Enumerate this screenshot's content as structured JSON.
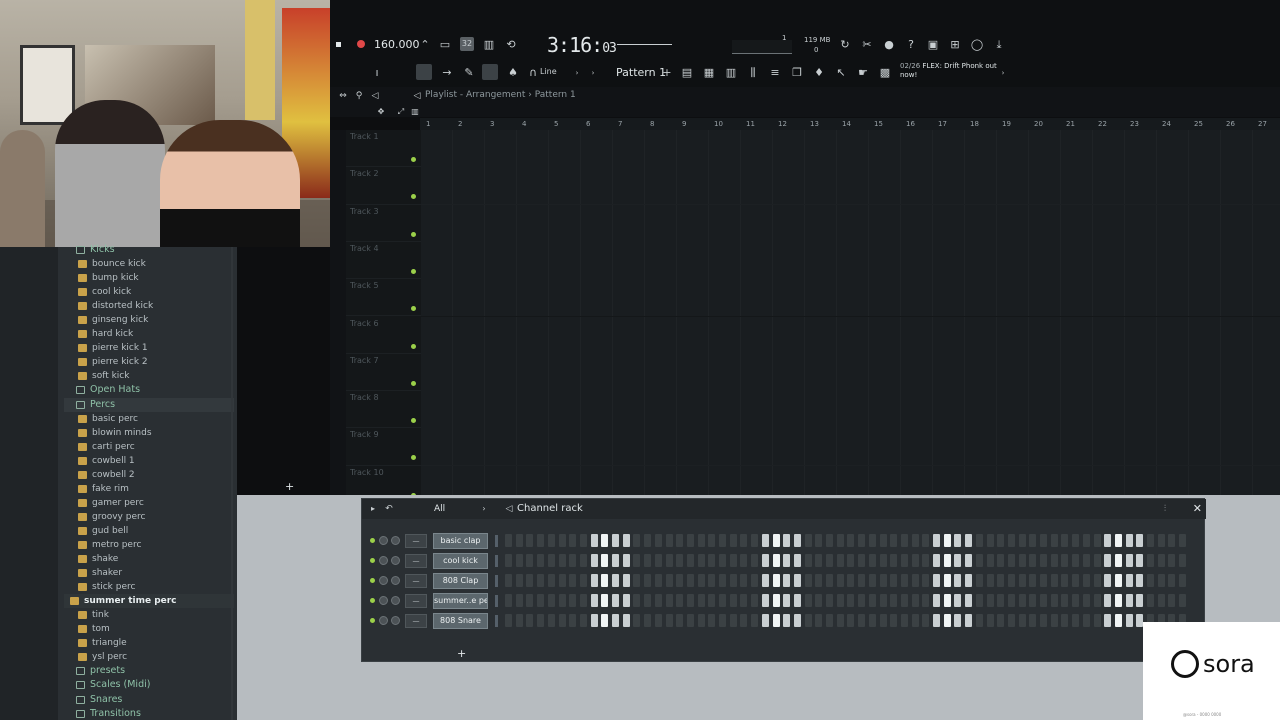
{
  "toolbar": {
    "bpm": "160.000",
    "time_main": "3:16:",
    "time_small": "03",
    "mode_label": "32",
    "snap_label": "Line",
    "pattern_label": "Pattern 1",
    "memory": "119 MB",
    "memory_sub": "0",
    "cpu_num": "1",
    "news_date": "02/26",
    "news_text": "FLEX: Drift Phonk out now!"
  },
  "playlist": {
    "breadcrumb_view": "Playlist - Arrangement",
    "breadcrumb_sep": "›",
    "breadcrumb_pattern": "Pattern 1",
    "ruler_labels": [
      "1",
      "2",
      "3",
      "4",
      "5",
      "6",
      "7",
      "8",
      "9",
      "10",
      "11",
      "12",
      "13",
      "14",
      "15",
      "16",
      "17",
      "18",
      "19",
      "20",
      "21",
      "22",
      "23",
      "24",
      "25",
      "26",
      "27"
    ],
    "tracks": [
      "Track 1",
      "Track 2",
      "Track 3",
      "Track 4",
      "Track 5",
      "Track 6",
      "Track 7",
      "Track 8",
      "Track 9",
      "Track 10"
    ]
  },
  "browser": {
    "items": [
      {
        "label": "Kicks",
        "type": "folder"
      },
      {
        "label": "bounce kick",
        "type": "file"
      },
      {
        "label": "bump kick",
        "type": "file"
      },
      {
        "label": "cool kick",
        "type": "file"
      },
      {
        "label": "distorted kick",
        "type": "file"
      },
      {
        "label": "ginseng kick",
        "type": "file"
      },
      {
        "label": "hard kick",
        "type": "file"
      },
      {
        "label": "pierre kick 1",
        "type": "file"
      },
      {
        "label": "pierre kick 2",
        "type": "file"
      },
      {
        "label": "soft kick",
        "type": "file"
      },
      {
        "label": "Open Hats",
        "type": "folder"
      },
      {
        "label": "Percs",
        "type": "folder-open"
      },
      {
        "label": "basic perc",
        "type": "file"
      },
      {
        "label": "blowin minds",
        "type": "file"
      },
      {
        "label": "carti perc",
        "type": "file"
      },
      {
        "label": "cowbell 1",
        "type": "file"
      },
      {
        "label": "cowbell 2",
        "type": "file"
      },
      {
        "label": "fake rim",
        "type": "file"
      },
      {
        "label": "gamer perc",
        "type": "file"
      },
      {
        "label": "groovy perc",
        "type": "file"
      },
      {
        "label": "gud bell",
        "type": "file"
      },
      {
        "label": "metro perc",
        "type": "file"
      },
      {
        "label": "shake",
        "type": "file"
      },
      {
        "label": "shaker",
        "type": "file"
      },
      {
        "label": "stick perc",
        "type": "file"
      },
      {
        "label": "summer time perc",
        "type": "selected"
      },
      {
        "label": "tink",
        "type": "file"
      },
      {
        "label": "tom",
        "type": "file"
      },
      {
        "label": "triangle",
        "type": "file"
      },
      {
        "label": "ysl perc",
        "type": "file"
      },
      {
        "label": "presets",
        "type": "folder"
      },
      {
        "label": "Scales (Midi)",
        "type": "folder"
      },
      {
        "label": "Snares",
        "type": "folder"
      },
      {
        "label": "Transitions",
        "type": "folder"
      }
    ]
  },
  "channel_rack": {
    "title": "Channel rack",
    "filter": "All",
    "channels": [
      {
        "name": "basic clap",
        "steps": "0000000000010111"
      },
      {
        "name": "cool kick",
        "steps": "0000000000011111"
      },
      {
        "name": "808 Clap",
        "steps": "0000000000011111"
      },
      {
        "name": "summer..e perc",
        "steps": "0000000000011111"
      },
      {
        "name": "808 Snare",
        "steps": "0000000000011111"
      }
    ],
    "add_label": "+"
  },
  "watermark": {
    "brand": "sora",
    "tiny": "@sora - 0000 0000"
  },
  "colors": {
    "accent_green": "#9bd04a",
    "record_red": "#e04848"
  }
}
